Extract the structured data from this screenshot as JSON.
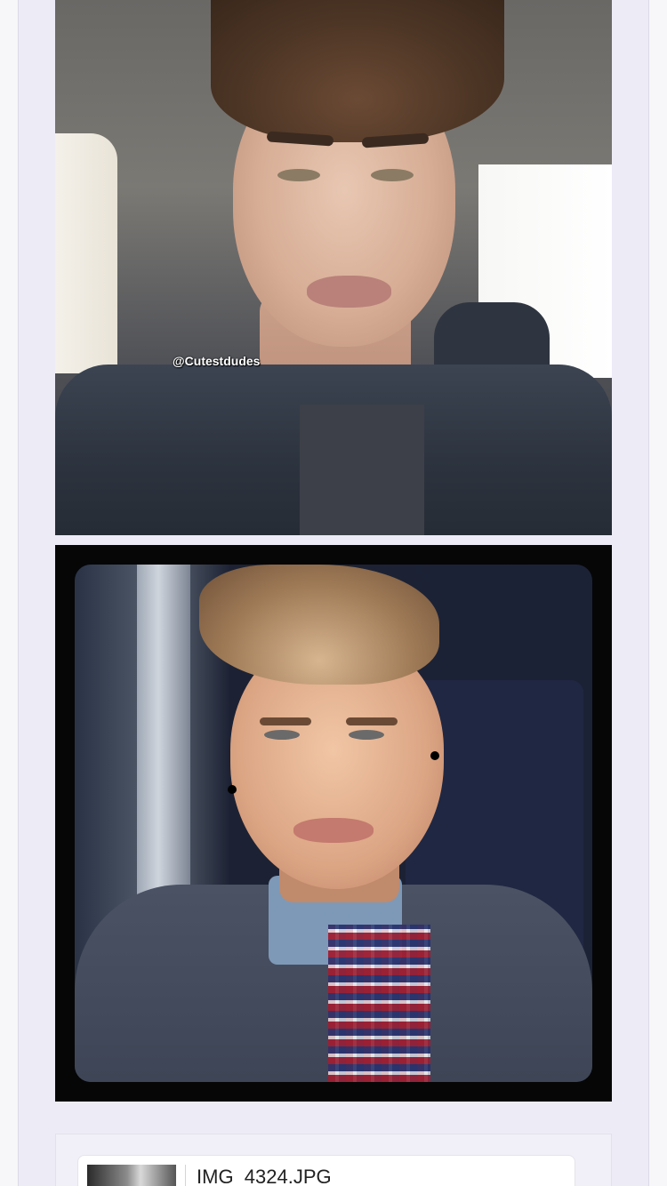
{
  "post": {
    "photos": [
      {
        "watermark": "@Cutestdudes"
      },
      {
        "watermark": ""
      }
    ],
    "attachment": {
      "file_name": "IMG_4324.JPG"
    }
  },
  "colors": {
    "column_background": "#ecebf6",
    "page_background": "#f7f7f9",
    "frame_black": "#060607"
  }
}
